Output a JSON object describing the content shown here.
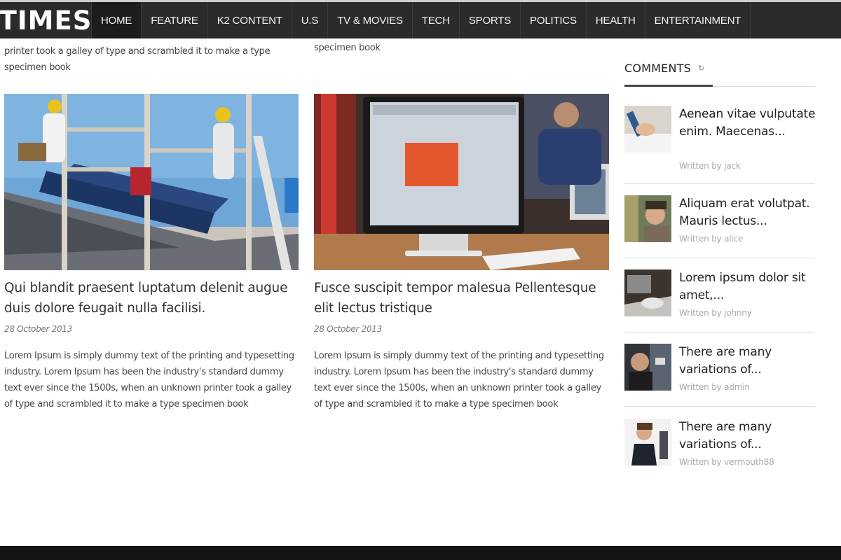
{
  "site": {
    "logo": "TIMES"
  },
  "nav": {
    "items": [
      {
        "label": "HOME",
        "active": true
      },
      {
        "label": "FEATURE"
      },
      {
        "label": "K2 CONTENT"
      },
      {
        "label": "U.S"
      },
      {
        "label": "TV & MOVIES"
      },
      {
        "label": "TECH"
      },
      {
        "label": "SPORTS"
      },
      {
        "label": "POLITICS"
      },
      {
        "label": "HEALTH"
      },
      {
        "label": "ENTERTAINMENT"
      }
    ]
  },
  "top_snippets": {
    "left_line1": "printer took a galley of type and scrambled it to make a type",
    "left_line2": "specimen book",
    "right_line": "specimen book"
  },
  "articles": [
    {
      "title": "Qui blandit praesent luptatum delenit augue duis dolore feugait nulla facilisi.",
      "date": "28 October 2013",
      "body": "Lorem Ipsum is simply dummy text of the printing and typesetting industry. Lorem Ipsum has been the industry's standard dummy text ever since the 1500s, when an unknown printer took a galley of type and scrambled it to make a type specimen book",
      "image_icon": "solar-panel-workers-photo"
    },
    {
      "title": "Fusce suscipit tempor malesua Pellentesque elit lectus tristique",
      "date": "28 October 2013",
      "body": "Lorem Ipsum is simply dummy text of the printing and typesetting industry. Lorem Ipsum has been the industry's standard dummy text ever since the 1500s, when an unknown printer took a galley of type and scrambled it to make a type specimen book",
      "image_icon": "computer-desk-photo"
    }
  ],
  "sidebar": {
    "heading": "COMMENTS",
    "refresh_icon": "refresh-icon",
    "comments": [
      {
        "text": "Aenean vitae vulputate enim. Maecenas...",
        "by": "Written by jack"
      },
      {
        "text": "Aliquam erat volutpat. Mauris lectus...",
        "by": "Written by alice"
      },
      {
        "text": "Lorem ipsum dolor sit amet,...",
        "by": "Written by johnny"
      },
      {
        "text": "There are many variations of...",
        "by": "Written by admin"
      },
      {
        "text": "There are many variations of...",
        "by": "Written by vermouth88"
      }
    ]
  },
  "colors": {
    "nav_bg": "#2b2b2b",
    "footer_bg": "#121418",
    "accent_orange": "#e4572e"
  }
}
